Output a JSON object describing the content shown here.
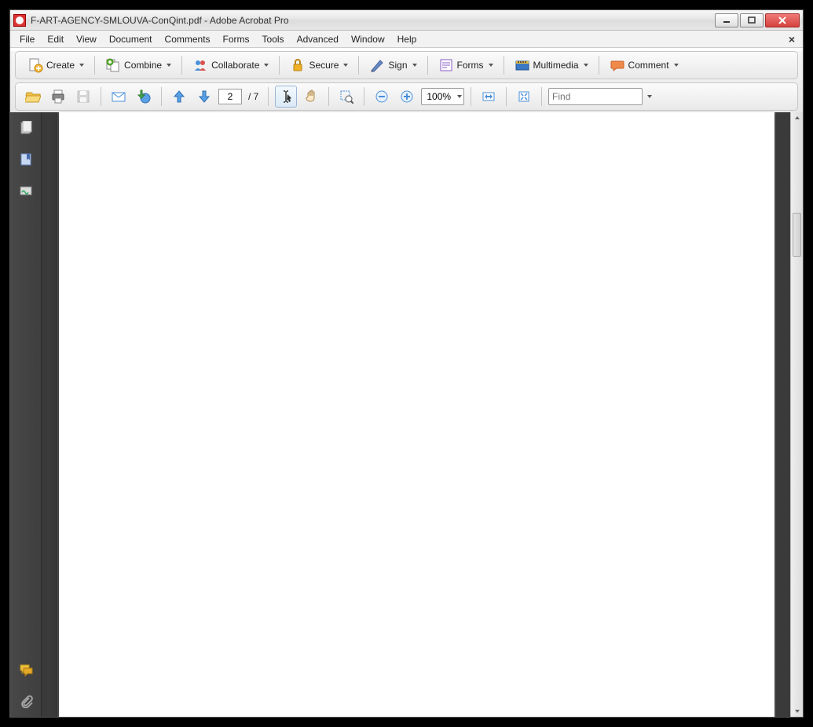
{
  "title": "F-ART-AGENCY-SMLOUVA-ConQint.pdf - Adobe Acrobat Pro",
  "menus": [
    "File",
    "Edit",
    "View",
    "Document",
    "Comments",
    "Forms",
    "Tools",
    "Advanced",
    "Window",
    "Help"
  ],
  "toolbar1": {
    "create": "Create",
    "combine": "Combine",
    "collaborate": "Collaborate",
    "secure": "Secure",
    "sign": "Sign",
    "forms": "Forms",
    "multimedia": "Multimedia",
    "comment": "Comment"
  },
  "toolbar2": {
    "page_current": "2",
    "page_sep": "/ 7",
    "zoom_value": "100%",
    "find_placeholder": "Find"
  }
}
